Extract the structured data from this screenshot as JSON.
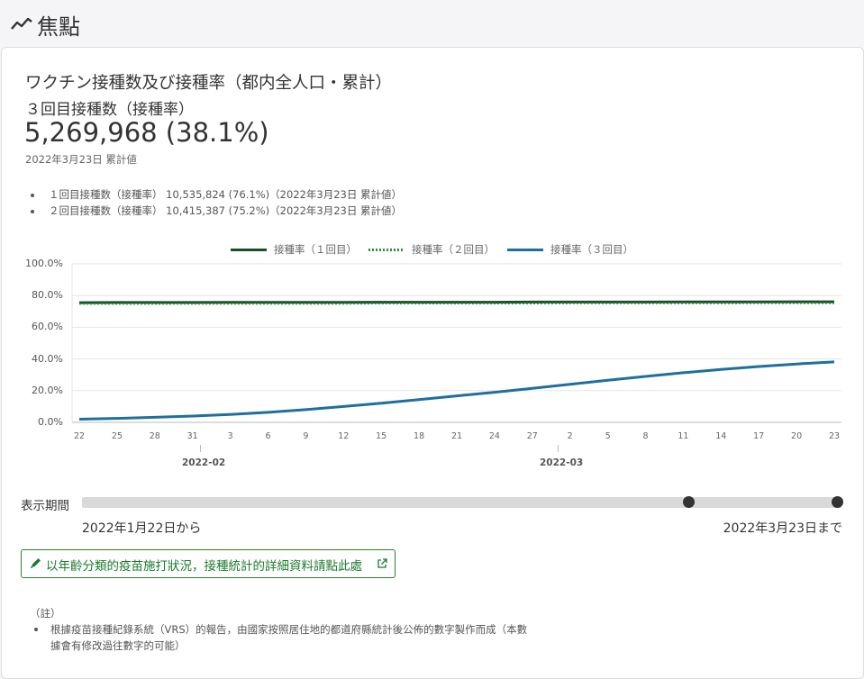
{
  "header": {
    "title": "焦點"
  },
  "card": {
    "title": "ワクチン接種数及び接種率（都内全人口・累計）",
    "subtitle": "３回目接種数（接種率）",
    "big_value": "5,269,968 (38.1%)",
    "as_of": "2022年3月23日 累計値",
    "bullets": [
      "１回目接種数（接種率） 10,535,824 (76.1%)（2022年3月23日 累計値）",
      "２回目接種数（接種率） 10,415,387 (75.2%)（2022年3月23日 累計値）"
    ]
  },
  "chart_data": {
    "type": "line",
    "legend": [
      "接種率（１回目）",
      "接種率（２回目）",
      "接種率（３回目）"
    ],
    "legend_position": "top-center",
    "y_ticks": [
      "100.0%",
      "80.0%",
      "60.0%",
      "40.0%",
      "20.0%",
      "0.0%"
    ],
    "ylim": [
      0,
      100
    ],
    "x_tick_labels": [
      "22",
      "25",
      "28",
      "31",
      "3",
      "6",
      "9",
      "12",
      "15",
      "18",
      "21",
      "24",
      "27",
      "2",
      "5",
      "8",
      "11",
      "14",
      "17",
      "20",
      "23"
    ],
    "x_month_labels": [
      "2022-02",
      "2022-03"
    ],
    "x": [
      "2022-01-22",
      "2022-01-25",
      "2022-01-28",
      "2022-01-31",
      "2022-02-03",
      "2022-02-06",
      "2022-02-09",
      "2022-02-12",
      "2022-02-15",
      "2022-02-18",
      "2022-02-21",
      "2022-02-24",
      "2022-02-27",
      "2022-03-02",
      "2022-03-05",
      "2022-03-08",
      "2022-03-11",
      "2022-03-14",
      "2022-03-17",
      "2022-03-20",
      "2022-03-23"
    ],
    "series": [
      {
        "name": "接種率（１回目）",
        "color": "#1b4d2b",
        "style": "solid",
        "values": [
          75.5,
          75.6,
          75.6,
          75.6,
          75.7,
          75.7,
          75.7,
          75.7,
          75.8,
          75.8,
          75.8,
          75.8,
          75.9,
          75.9,
          75.9,
          75.9,
          76.0,
          76.0,
          76.0,
          76.1,
          76.1
        ]
      },
      {
        "name": "接種率（２回目）",
        "color": "#2e8b3e",
        "style": "dotted",
        "values": [
          74.8,
          74.8,
          74.8,
          74.9,
          74.9,
          74.9,
          74.9,
          74.9,
          75.0,
          75.0,
          75.0,
          75.0,
          75.0,
          75.1,
          75.1,
          75.1,
          75.1,
          75.1,
          75.2,
          75.2,
          75.2
        ]
      },
      {
        "name": "接種率（３回目）",
        "color": "#1f6f9f",
        "style": "solid",
        "values": [
          2.0,
          2.5,
          3.2,
          4.0,
          5.0,
          6.3,
          8.0,
          10.0,
          12.1,
          14.4,
          16.7,
          19.0,
          21.5,
          24.0,
          26.6,
          29.0,
          31.3,
          33.4,
          35.2,
          36.8,
          38.1
        ]
      }
    ]
  },
  "period": {
    "label": "表示期間",
    "from": "2022年1月22日から",
    "to": "2022年3月23日まで",
    "start_fraction": 0.8,
    "end_fraction": 1.0
  },
  "link": {
    "label": "以年齡分類的疫苗施打狀況，接種統計的詳細資料請點此處"
  },
  "notes": {
    "heading": "（註）",
    "items": [
      "根據疫苗接種紀錄系統（VRS）的報告，由國家按照居住地的都道府縣統計後公佈的數字製作而成（本數",
      "據會有修改過往數字的可能）"
    ]
  },
  "colors": {
    "accent_green": "#2e7d32",
    "series3": "#1f6f9f"
  }
}
